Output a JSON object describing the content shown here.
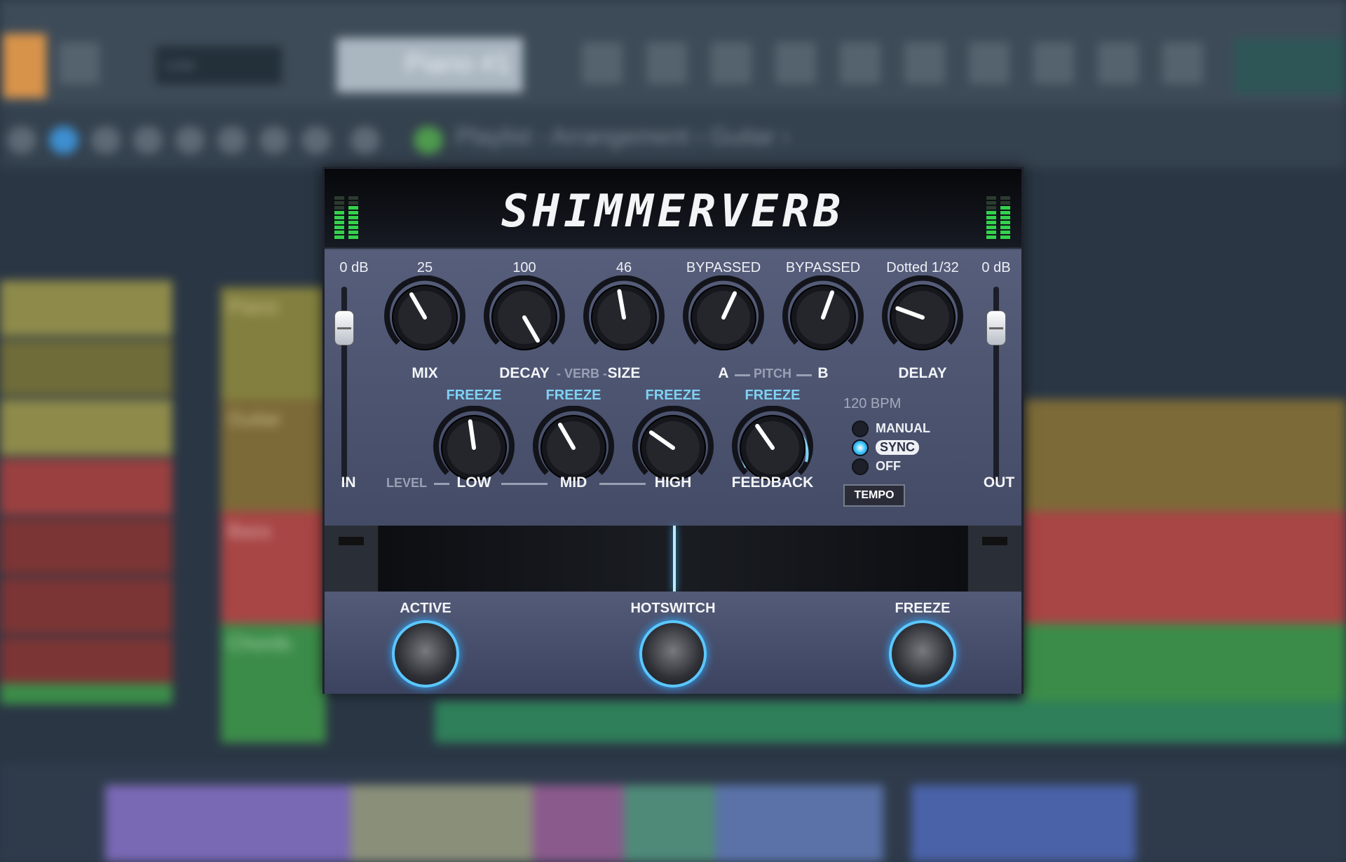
{
  "daw": {
    "toolbar_pattern": "Piano #1",
    "toolbar_dropdown": "Line",
    "playlist_title": "Playlist - Arrangement › Guitar ›",
    "tracks": [
      "Piano",
      "Guitar",
      "Bass",
      "Chords"
    ]
  },
  "plugin": {
    "title": "SHIMMERVERB",
    "in_level": "0 dB",
    "out_level": "0 dB",
    "in_label": "IN",
    "out_label": "OUT",
    "knobs": [
      {
        "id": "mix",
        "value": "25",
        "label": "MIX"
      },
      {
        "id": "decay",
        "value": "100",
        "label": "DECAY"
      },
      {
        "id": "size",
        "value": "46",
        "label": "SIZE"
      },
      {
        "id": "pitch-a",
        "value": "BYPASSED",
        "label": "A"
      },
      {
        "id": "pitch-b",
        "value": "BYPASSED",
        "label": "B"
      },
      {
        "id": "delay",
        "value": "Dotted 1/32",
        "label": "DELAY"
      }
    ],
    "verb_group": "VERB",
    "pitch_group": "PITCH",
    "level_group": "LEVEL",
    "freeze_label": "FREEZE",
    "eq_knobs": [
      {
        "id": "low",
        "label": "LOW"
      },
      {
        "id": "mid",
        "label": "MID"
      },
      {
        "id": "high",
        "label": "HIGH"
      },
      {
        "id": "feedback",
        "label": "FEEDBACK"
      }
    ],
    "bpm": "120 BPM",
    "sync_modes": [
      "MANUAL",
      "SYNC",
      "OFF"
    ],
    "sync_selected": "SYNC",
    "tempo_button": "TEMPO",
    "footswitches": [
      {
        "id": "active",
        "label": "ACTIVE"
      },
      {
        "id": "hotswitch",
        "label": "HOTSWITCH"
      },
      {
        "id": "freeze",
        "label": "FREEZE"
      }
    ],
    "colors": {
      "accent": "#5bc8ff",
      "meter": "#34d24c",
      "panel": "#4d5570"
    }
  }
}
